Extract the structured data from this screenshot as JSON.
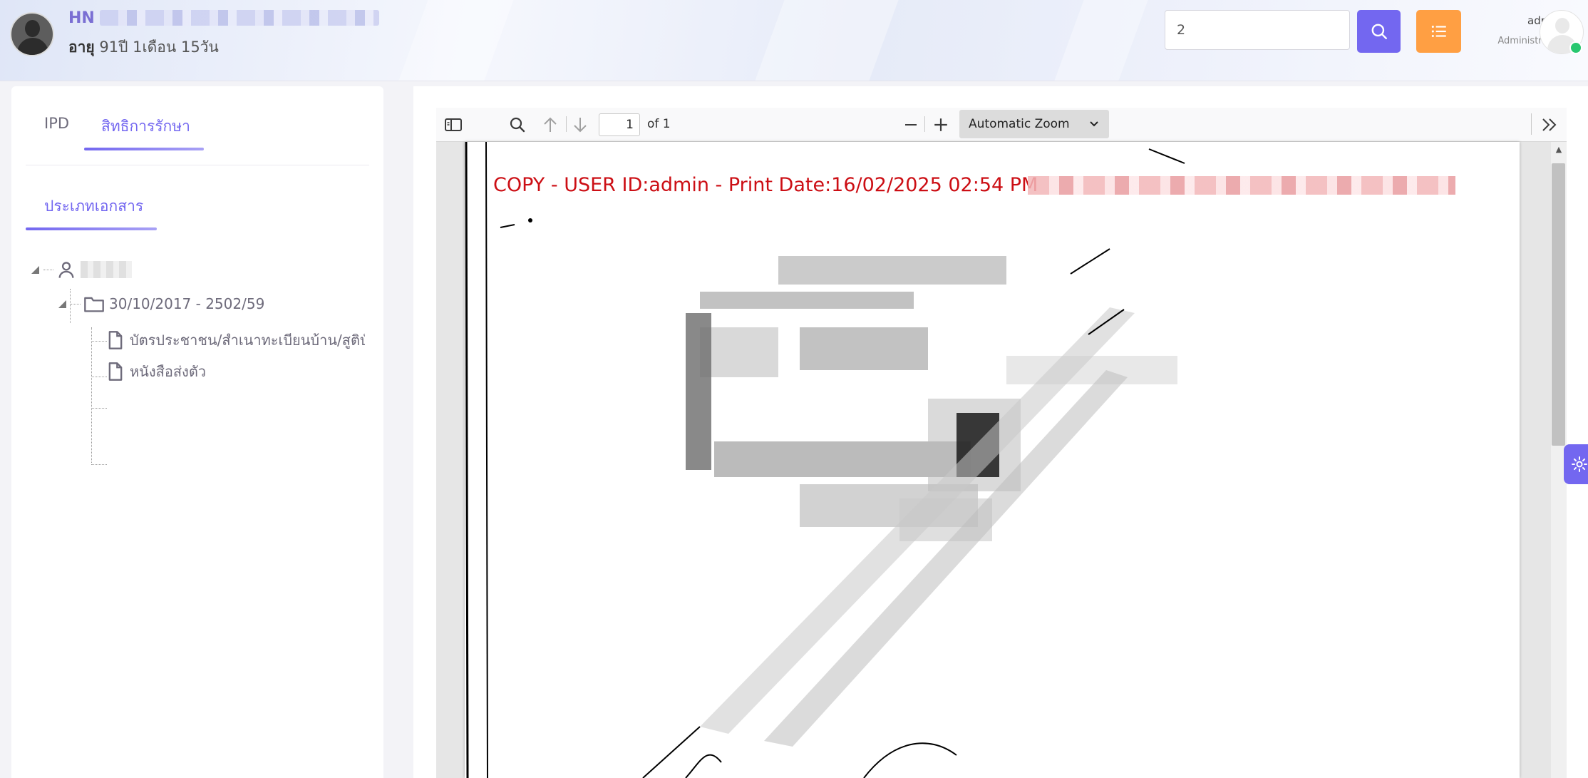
{
  "header": {
    "hn_label": "HN",
    "age_label": "อายุ",
    "age_value": "91ปี 1เดือน 15วัน",
    "search": {
      "value": "2"
    },
    "user": {
      "name": "admin",
      "role": "Administrator"
    }
  },
  "left_panel": {
    "tabs": [
      {
        "label": "IPD",
        "active": false
      },
      {
        "label": "สิทธิการรักษา",
        "active": true
      }
    ],
    "section_tab": "ประเภทเอกสาร",
    "tree": {
      "folder": "30/10/2017 - 2502/59",
      "documents": [
        "บัตรประชาชน/สำเนาทะเบียนบ้าน/สูติบั",
        "หนังสือส่งตัว"
      ]
    }
  },
  "pdf_viewer": {
    "page_current": "1",
    "page_total": "of 1",
    "zoom": "Automatic Zoom",
    "watermark": "COPY - USER ID:admin - Print Date:16/02/2025 02:54 PM"
  },
  "colors": {
    "primary": "#7367f0",
    "warning": "#ff9f43",
    "online": "#28c76f",
    "watermark": "#cc0e14"
  },
  "icons": [
    "patient-avatar-icon",
    "search-icon",
    "list-icon",
    "user-avatar-icon",
    "user-icon",
    "folder-icon",
    "file-icon",
    "sidebar-toggle-icon",
    "find-icon",
    "arrow-up-icon",
    "arrow-down-icon",
    "minus-icon",
    "plus-icon",
    "chevron-down-icon",
    "double-chevron-right-icon",
    "gear-icon"
  ]
}
